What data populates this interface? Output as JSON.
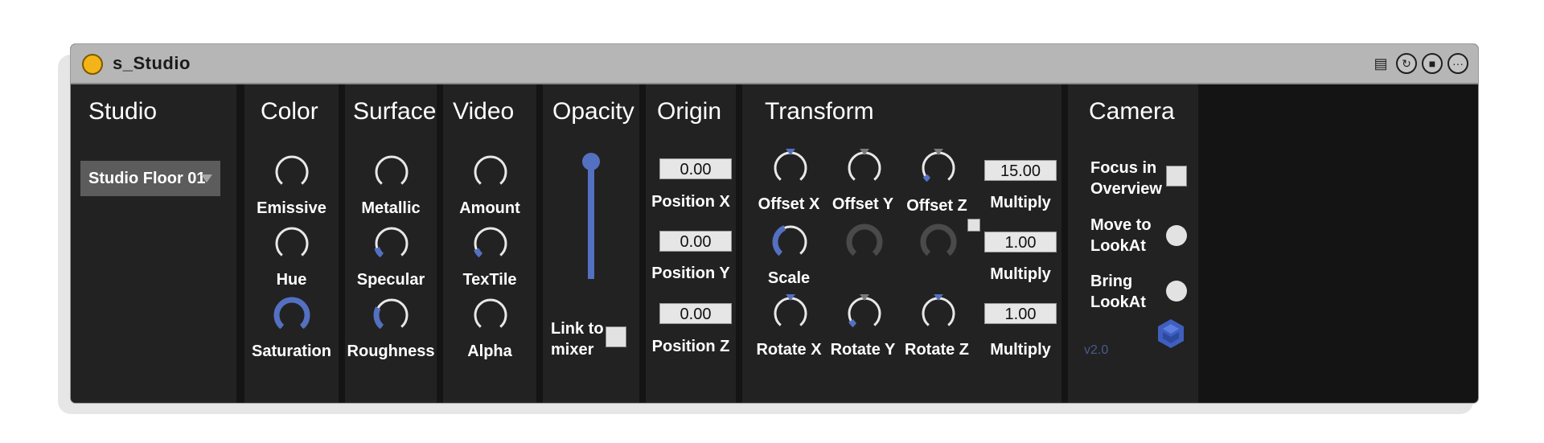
{
  "window": {
    "title": "s_Studio",
    "icons": [
      "calendar-icon",
      "refresh-icon",
      "save-icon",
      "more-icon"
    ]
  },
  "colors": {
    "accent": "#5470c0",
    "inactive_knob": "#4a4a4a",
    "panel": "#222222"
  },
  "studio": {
    "title": "Studio",
    "dropdown_value": "Studio Floor 01"
  },
  "color": {
    "title": "Color",
    "knobs": [
      {
        "label": "Emissive",
        "value": 0.0
      },
      {
        "label": "Hue",
        "value": 0.0
      },
      {
        "label": "Saturation",
        "value": 1.0
      }
    ]
  },
  "surface": {
    "title": "Surface",
    "knobs": [
      {
        "label": "Metallic",
        "value": 0.0
      },
      {
        "label": "Specular",
        "value": 0.12
      },
      {
        "label": "Roughness",
        "value": 0.28
      }
    ]
  },
  "video": {
    "title": "Video",
    "knobs": [
      {
        "label": "Amount",
        "value": 0.0
      },
      {
        "label": "TexTile",
        "value": 0.1
      },
      {
        "label": "Alpha",
        "value": 0.0
      }
    ]
  },
  "opacity": {
    "title": "Opacity",
    "slider_value": 1.0,
    "link_label_1": "Link to",
    "link_label_2": "mixer"
  },
  "origin": {
    "title": "Origin",
    "fields": [
      {
        "label": "Position X",
        "value": "0.00"
      },
      {
        "label": "Position Y",
        "value": "0.00"
      },
      {
        "label": "Position Z",
        "value": "0.00"
      }
    ]
  },
  "transform": {
    "title": "Transform",
    "offset_x": "Offset X",
    "offset_y": "Offset Y",
    "offset_z": "Offset Z",
    "scale": "Scale",
    "rotate_x": "Rotate X",
    "rotate_y": "Rotate Y",
    "rotate_z": "Rotate Z",
    "multiply_label": "Multiply",
    "multiply_values": [
      "15.00",
      "1.00",
      "1.00"
    ],
    "offset_z_value": 0.07,
    "scale_value": 0.42,
    "rotate_y_value": 0.08
  },
  "camera": {
    "title": "Camera",
    "focus_1": "Focus in",
    "focus_2": "Overview",
    "move_1": "Move to",
    "move_2": "LookAt",
    "bring_1": "Bring",
    "bring_2": "LookAt",
    "version": "v2.0"
  }
}
